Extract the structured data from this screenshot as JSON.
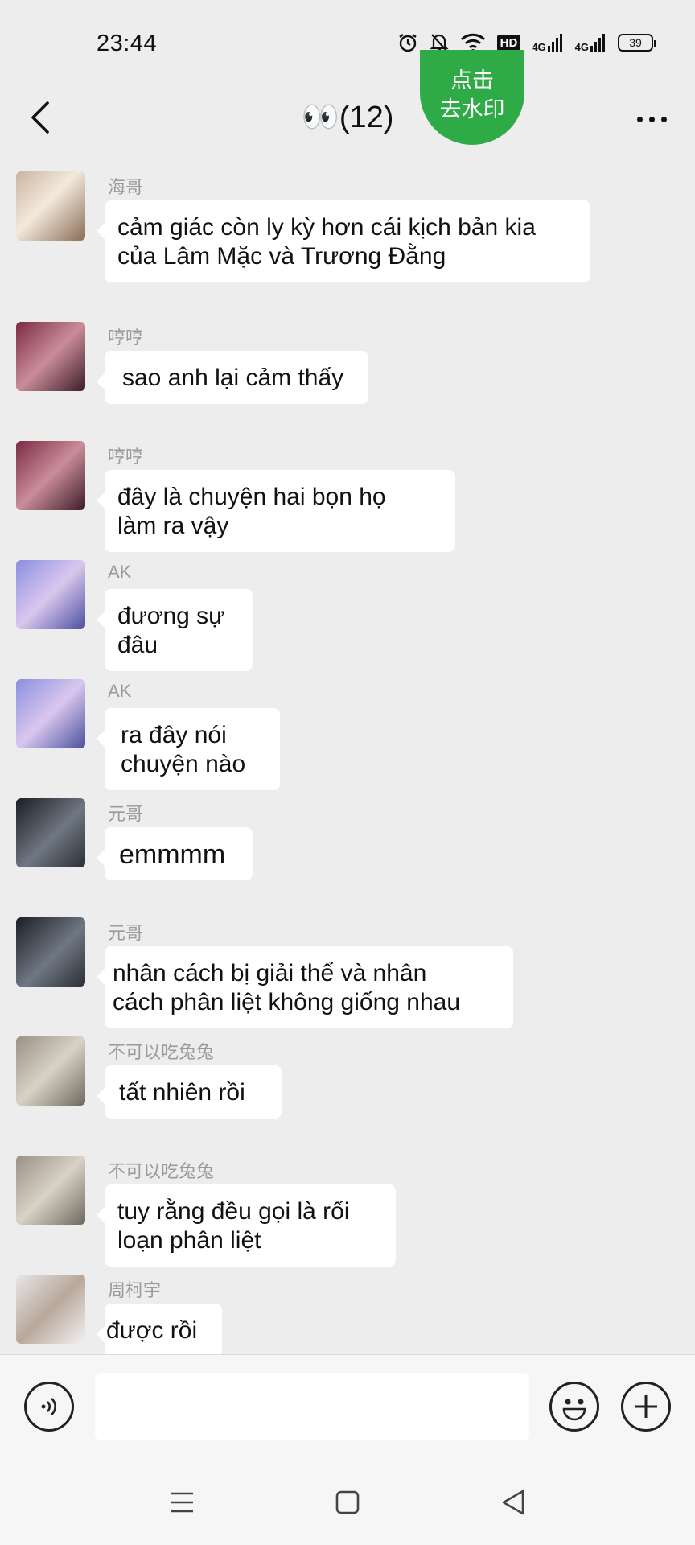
{
  "status_bar": {
    "time": "23:44",
    "hd_label": "HD",
    "network_1": "4G",
    "network_2": "4G",
    "battery": "39"
  },
  "header": {
    "title": "👀(12)",
    "watermark_line1": "点击",
    "watermark_line2": "去水印",
    "back_icon": "chevron-left-icon",
    "more_icon": "more-dots-icon"
  },
  "messages": [
    {
      "sender": "海哥",
      "text_lines": [
        "cảm giác còn ly kỳ hơn cái kịch bản kia",
        "của Lâm Mặc và Trương Đằng"
      ]
    },
    {
      "sender": "哼哼",
      "text_lines": [
        "sao anh lại cảm thấy"
      ]
    },
    {
      "sender": "哼哼",
      "text_lines": [
        "đây là chuyện hai bọn họ",
        "làm ra vậy"
      ]
    },
    {
      "sender": "AK",
      "text_lines": [
        "đương sự đâu"
      ]
    },
    {
      "sender": "AK",
      "text_lines": [
        "ra đây nói",
        "chuyện nào"
      ]
    },
    {
      "sender": "元哥",
      "text_lines": [
        "emmmm"
      ]
    },
    {
      "sender": "元哥",
      "text_lines": [
        "nhân cách bị giải thể và nhân",
        "cách phân liệt không giống nhau"
      ]
    },
    {
      "sender": "不可以吃兔兔",
      "text_lines": [
        "tất nhiên rồi"
      ]
    },
    {
      "sender": "不可以吃兔兔",
      "text_lines": [
        "tuy rằng đều gọi là rối",
        "loạn phân liệt"
      ]
    },
    {
      "sender": "周柯宇",
      "text_lines": [
        "được rồi"
      ]
    }
  ],
  "input_bar": {
    "placeholder": "",
    "voice_icon": "voice-icon",
    "emoji_icon": "emoji-icon",
    "plus_icon": "plus-icon"
  },
  "nav_bar": {
    "menu_icon": "menu-icon",
    "home_icon": "home-icon",
    "back_icon": "back-triangle-icon"
  },
  "colors": {
    "background": "#ededed",
    "bubble": "#ffffff",
    "watermark_button": "#2eab46",
    "sender_text": "#9a9a9a"
  }
}
